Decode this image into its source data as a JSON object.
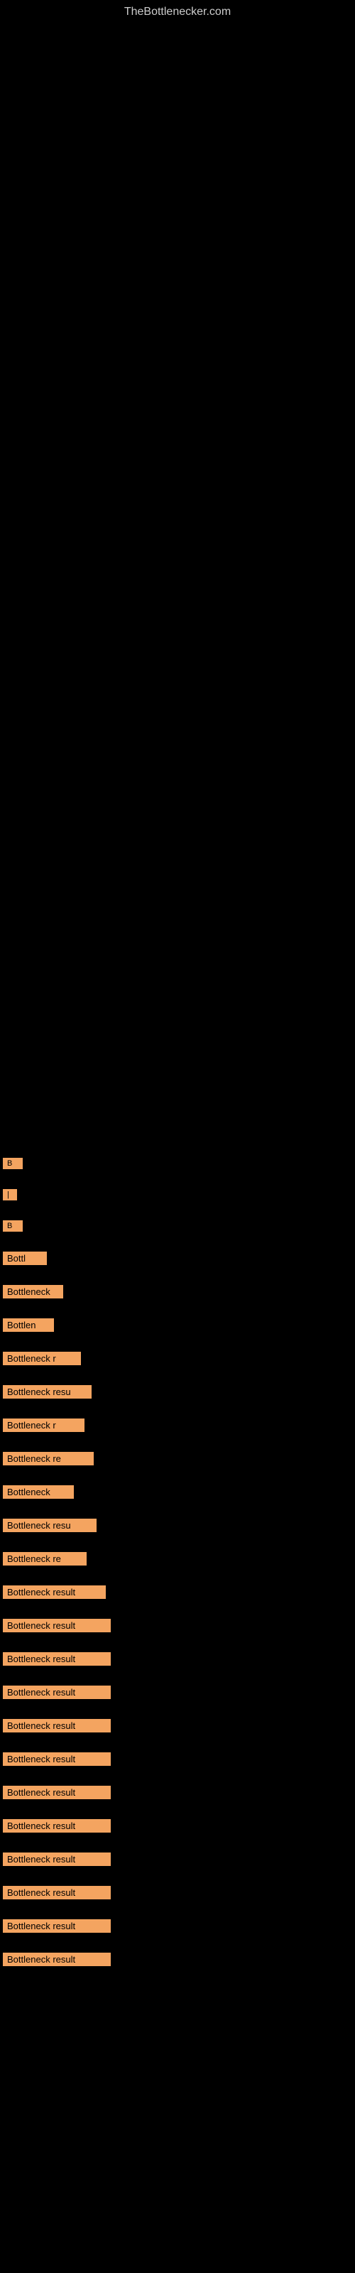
{
  "header": {
    "site_title": "TheBottlenecker.com"
  },
  "items": [
    {
      "id": 1,
      "label": "B",
      "class": "item-1"
    },
    {
      "id": 2,
      "label": "|",
      "class": "item-2"
    },
    {
      "id": 3,
      "label": "B",
      "class": "item-3"
    },
    {
      "id": 4,
      "label": "Bottl",
      "class": "item-4"
    },
    {
      "id": 5,
      "label": "Bottleneck",
      "class": "item-5"
    },
    {
      "id": 6,
      "label": "Bottlen",
      "class": "item-6"
    },
    {
      "id": 7,
      "label": "Bottleneck r",
      "class": "item-7"
    },
    {
      "id": 8,
      "label": "Bottleneck resu",
      "class": "item-8"
    },
    {
      "id": 9,
      "label": "Bottleneck r",
      "class": "item-9"
    },
    {
      "id": 10,
      "label": "Bottleneck re",
      "class": "item-10"
    },
    {
      "id": 11,
      "label": "Bottleneck",
      "class": "item-11"
    },
    {
      "id": 12,
      "label": "Bottleneck resu",
      "class": "item-12"
    },
    {
      "id": 13,
      "label": "Bottleneck re",
      "class": "item-13"
    },
    {
      "id": 14,
      "label": "Bottleneck result",
      "class": "item-14"
    },
    {
      "id": 15,
      "label": "Bottleneck result",
      "class": "item-15"
    },
    {
      "id": 16,
      "label": "Bottleneck result",
      "class": "item-16"
    },
    {
      "id": 17,
      "label": "Bottleneck result",
      "class": "item-17"
    },
    {
      "id": 18,
      "label": "Bottleneck result",
      "class": "item-18"
    },
    {
      "id": 19,
      "label": "Bottleneck result",
      "class": "item-19"
    },
    {
      "id": 20,
      "label": "Bottleneck result",
      "class": "item-20"
    },
    {
      "id": 21,
      "label": "Bottleneck result",
      "class": "item-21"
    },
    {
      "id": 22,
      "label": "Bottleneck result",
      "class": "item-22"
    },
    {
      "id": 23,
      "label": "Bottleneck result",
      "class": "item-23"
    },
    {
      "id": 24,
      "label": "Bottleneck result",
      "class": "item-24"
    },
    {
      "id": 25,
      "label": "Bottleneck result",
      "class": "item-25"
    }
  ]
}
